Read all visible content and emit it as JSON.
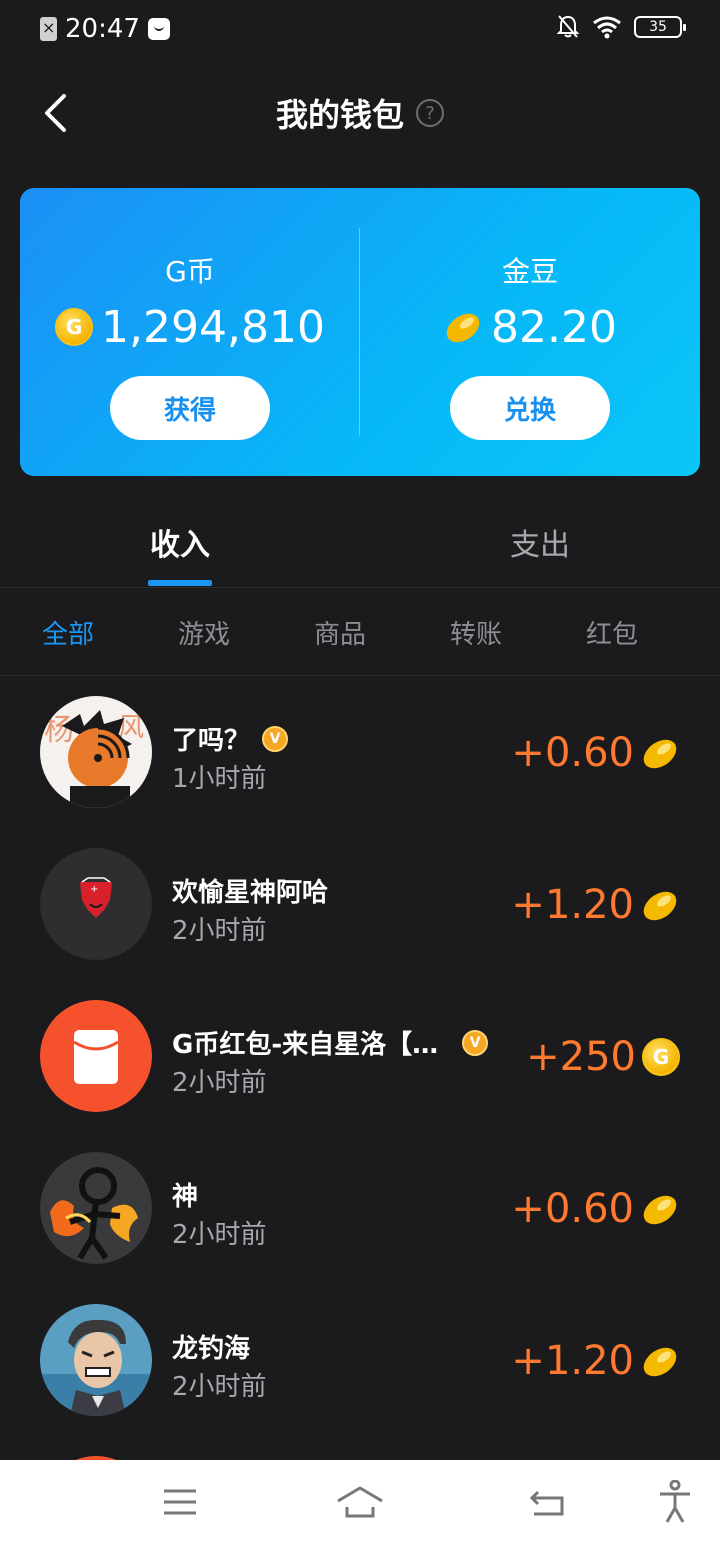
{
  "status_bar": {
    "time": "20:47",
    "battery": "35"
  },
  "header": {
    "title": "我的钱包",
    "help_glyph": "?"
  },
  "wallet": {
    "gcoin": {
      "label": "G币",
      "amount": "1,294,810",
      "button": "获得",
      "icon": "g-coin-icon"
    },
    "beans": {
      "label": "金豆",
      "amount": "82.20",
      "button": "兑换",
      "icon": "gold-bean-icon"
    }
  },
  "tabs": [
    {
      "label": "收入",
      "active": true
    },
    {
      "label": "支出",
      "active": false
    }
  ],
  "filters": [
    {
      "label": "全部",
      "active": true
    },
    {
      "label": "游戏",
      "active": false
    },
    {
      "label": "商品",
      "active": false
    },
    {
      "label": "转账",
      "active": false
    },
    {
      "label": "红包",
      "active": false
    }
  ],
  "transactions": [
    {
      "name": "了吗？",
      "verified": true,
      "time": "1小时前",
      "amount": "+0.60",
      "currency": "bean"
    },
    {
      "name": "欢愉星神阿哈",
      "verified": false,
      "time": "2小时前",
      "amount": "+1.20",
      "currency": "bean"
    },
    {
      "name": "G币红包-来自星洛【…",
      "verified": true,
      "time": "2小时前",
      "amount": "+250",
      "currency": "gcoin"
    },
    {
      "name": "神",
      "verified": false,
      "time": "2小时前",
      "amount": "+0.60",
      "currency": "bean"
    },
    {
      "name": "龙钓海",
      "verified": false,
      "time": "2小时前",
      "amount": "+1.20",
      "currency": "bean"
    }
  ],
  "colors": {
    "accent": "#1a97f5",
    "amount": "#ff7a2e",
    "background": "#1b1b1d"
  }
}
